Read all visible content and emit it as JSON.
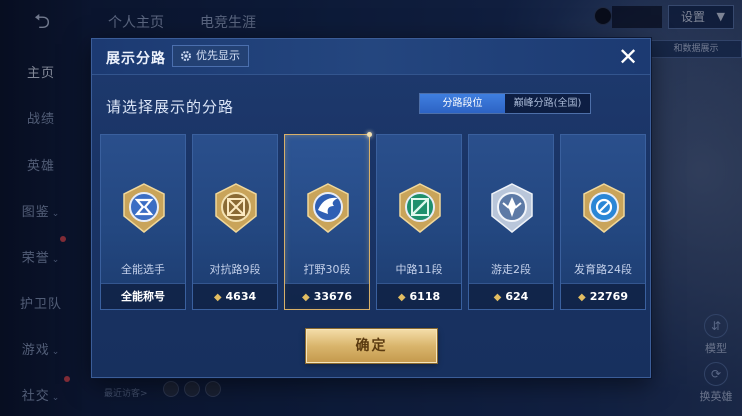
{
  "background": {
    "top_tabs": [
      "个人主页",
      "电竞生涯"
    ],
    "nav_items": [
      {
        "label": "主页",
        "active": true
      },
      {
        "label": "战绩",
        "active": false
      },
      {
        "label": "英雄",
        "active": false
      },
      {
        "label": "图鉴",
        "active": false,
        "arrow": "⌄"
      },
      {
        "label": "荣誉",
        "active": false,
        "arrow": "⌄"
      },
      {
        "label": "护卫队",
        "active": false
      },
      {
        "label": "游戏",
        "active": false,
        "arrow": "⌄"
      },
      {
        "label": "社交",
        "active": false,
        "arrow": "⌄"
      }
    ],
    "settings_label": "设置",
    "data_show_label": "和数据展示",
    "right_buttons": [
      {
        "label": "模型",
        "icon": "model-icon"
      },
      {
        "label": "换英雄",
        "icon": "swap-hero-icon"
      }
    ],
    "recent_visitors_label": "最近访客>"
  },
  "modal": {
    "title": "展示分路",
    "priority_label": "优先显示",
    "subtitle": "请选择展示的分路",
    "toggle_options": [
      {
        "label": "分路段位",
        "selected": true
      },
      {
        "label": "巅峰分路(全国)",
        "selected": false
      }
    ],
    "cards": [
      {
        "rank": "全能选手",
        "footer": "全能称号",
        "has_points": false,
        "selected": false,
        "emblem": "all-round-emblem-icon"
      },
      {
        "rank": "对抗路9段",
        "footer": "4634",
        "has_points": true,
        "selected": false,
        "emblem": "clash-lane-emblem-icon"
      },
      {
        "rank": "打野30段",
        "footer": "33676",
        "has_points": true,
        "selected": true,
        "emblem": "jungle-emblem-icon"
      },
      {
        "rank": "中路11段",
        "footer": "6118",
        "has_points": true,
        "selected": false,
        "emblem": "mid-lane-emblem-icon"
      },
      {
        "rank": "游走2段",
        "footer": "624",
        "has_points": true,
        "selected": false,
        "emblem": "roam-emblem-icon"
      },
      {
        "rank": "发育路24段",
        "footer": "22769",
        "has_points": true,
        "selected": false,
        "emblem": "farm-lane-emblem-icon"
      }
    ],
    "confirm_label": "确定",
    "close_icon": "close-icon"
  },
  "colors": {
    "accent_blue": "#3f7fe0",
    "gold": "#d9b56c",
    "panel": "#1e3a6e"
  }
}
